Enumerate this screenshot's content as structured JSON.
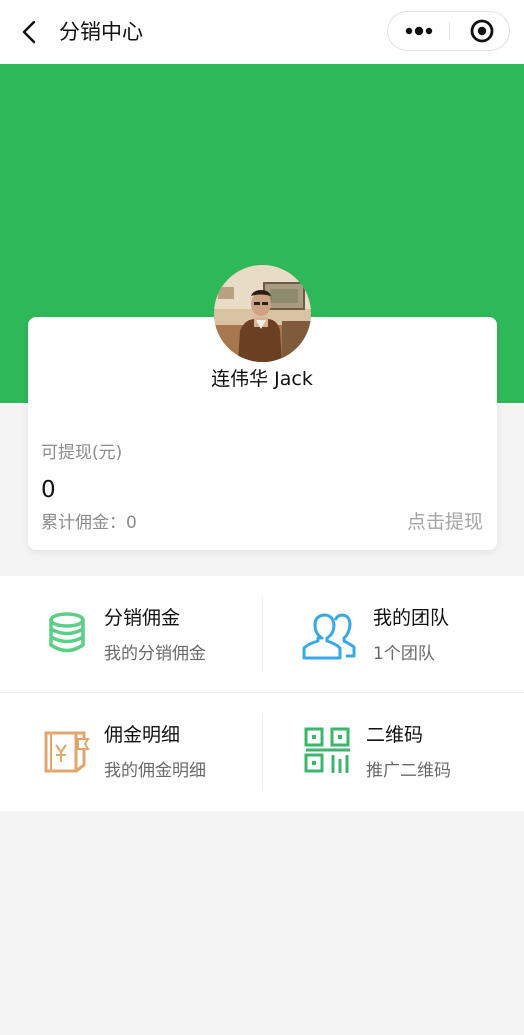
{
  "navbar": {
    "title": "分销中心",
    "back_icon": "chevron-left-icon",
    "more_icon": "more-dots-icon",
    "close_icon": "target-close-icon"
  },
  "colors": {
    "brand_green": "#2fb85a",
    "commission_icon": "#5ccf86",
    "team_icon": "#39a9e6",
    "detail_icon": "#e1a66a",
    "qrcode_icon": "#3cb66d"
  },
  "profile": {
    "name": "连伟华 Jack",
    "avatar_alt": "avatar"
  },
  "balance": {
    "label": "可提现(元)",
    "amount": "0",
    "total_commission": "累计佣金：0",
    "withdraw_link": "点击提现"
  },
  "menu": [
    {
      "title": "分销佣金",
      "subtitle": "我的分销佣金",
      "icon": "coins-stack-icon"
    },
    {
      "title": "我的团队",
      "subtitle": "1个团队",
      "icon": "team-users-icon"
    },
    {
      "title": "佣金明细",
      "subtitle": "我的佣金明细",
      "icon": "ledger-book-icon"
    },
    {
      "title": "二维码",
      "subtitle": "推广二维码",
      "icon": "qr-code-icon"
    }
  ]
}
